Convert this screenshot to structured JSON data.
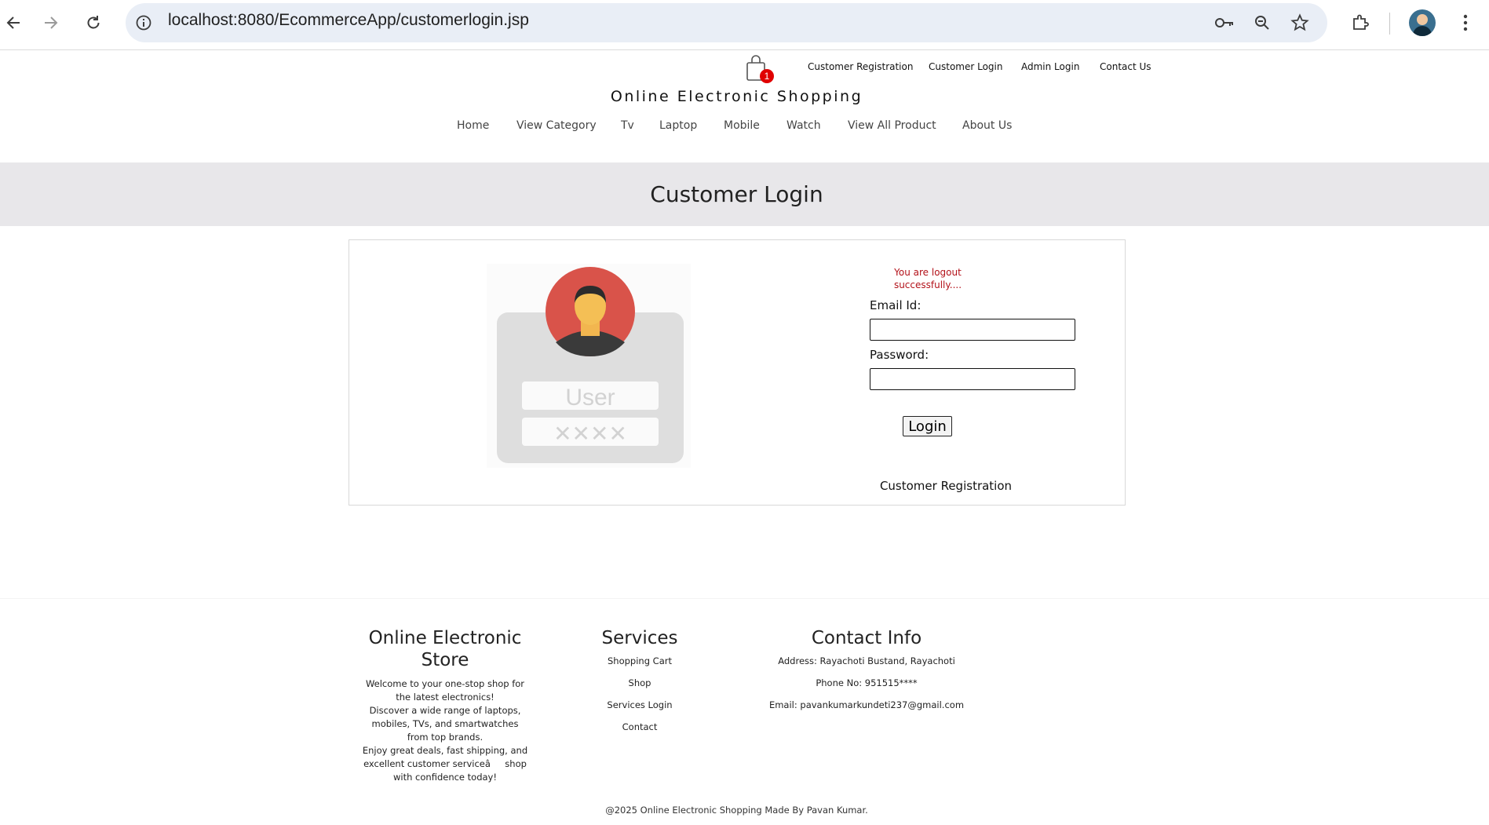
{
  "browser": {
    "url": "localhost:8080/EcommerceApp/customerlogin.jsp",
    "icons": [
      "back-icon",
      "forward-icon",
      "reload-icon",
      "site-info-icon",
      "password-key-icon",
      "zoom-icon",
      "bookmark-star-icon",
      "extensions-icon",
      "profile-avatar",
      "more-menu-icon"
    ]
  },
  "header": {
    "cart_count": "1",
    "top_links": [
      "Customer Registration",
      "Customer Login",
      "Admin Login",
      "Contact Us"
    ],
    "brand": "Online Electronic Shopping",
    "nav": [
      "Home",
      "View Category",
      "Tv",
      "Laptop",
      "Mobile",
      "Watch",
      "View All Product",
      "About Us"
    ]
  },
  "banner": {
    "title": "Customer Login"
  },
  "login": {
    "message": "You are logout successfully....",
    "email_label": "Email Id:",
    "email_value": "",
    "password_label": "Password:",
    "password_value": "",
    "login_button": "Login",
    "register_link": "Customer Registration",
    "illustration_text": "User",
    "illustration_mask": "✕✕✕✕"
  },
  "footer": {
    "about": {
      "heading": "Online Electronic Store",
      "text1": "Welcome to your one-stop shop for the latest electronics!",
      "text2": "Discover a wide range of laptops, mobiles, TVs, and smartwatches from top brands.",
      "text3": "Enjoy great deals, fast shipping, and excellent customer serviceâshop with confidence today!"
    },
    "services": {
      "heading": "Services",
      "links": [
        "Shopping Cart",
        "Shop",
        "Services Login",
        "Contact"
      ]
    },
    "contact": {
      "heading": "Contact Info",
      "address": "Address: Rayachoti Bustand, Rayachoti",
      "phone": "Phone No: 951515****",
      "email": "Email: pavankumarkundeti237@gmail.com"
    },
    "copyright": "@2025 Online Electronic Shopping Made By Pavan Kumar."
  },
  "colors": {
    "banner_bg": "#e8e7ea",
    "badge": "#e00000",
    "message": "#b3121a",
    "avatar_circle": "#d9534a"
  }
}
